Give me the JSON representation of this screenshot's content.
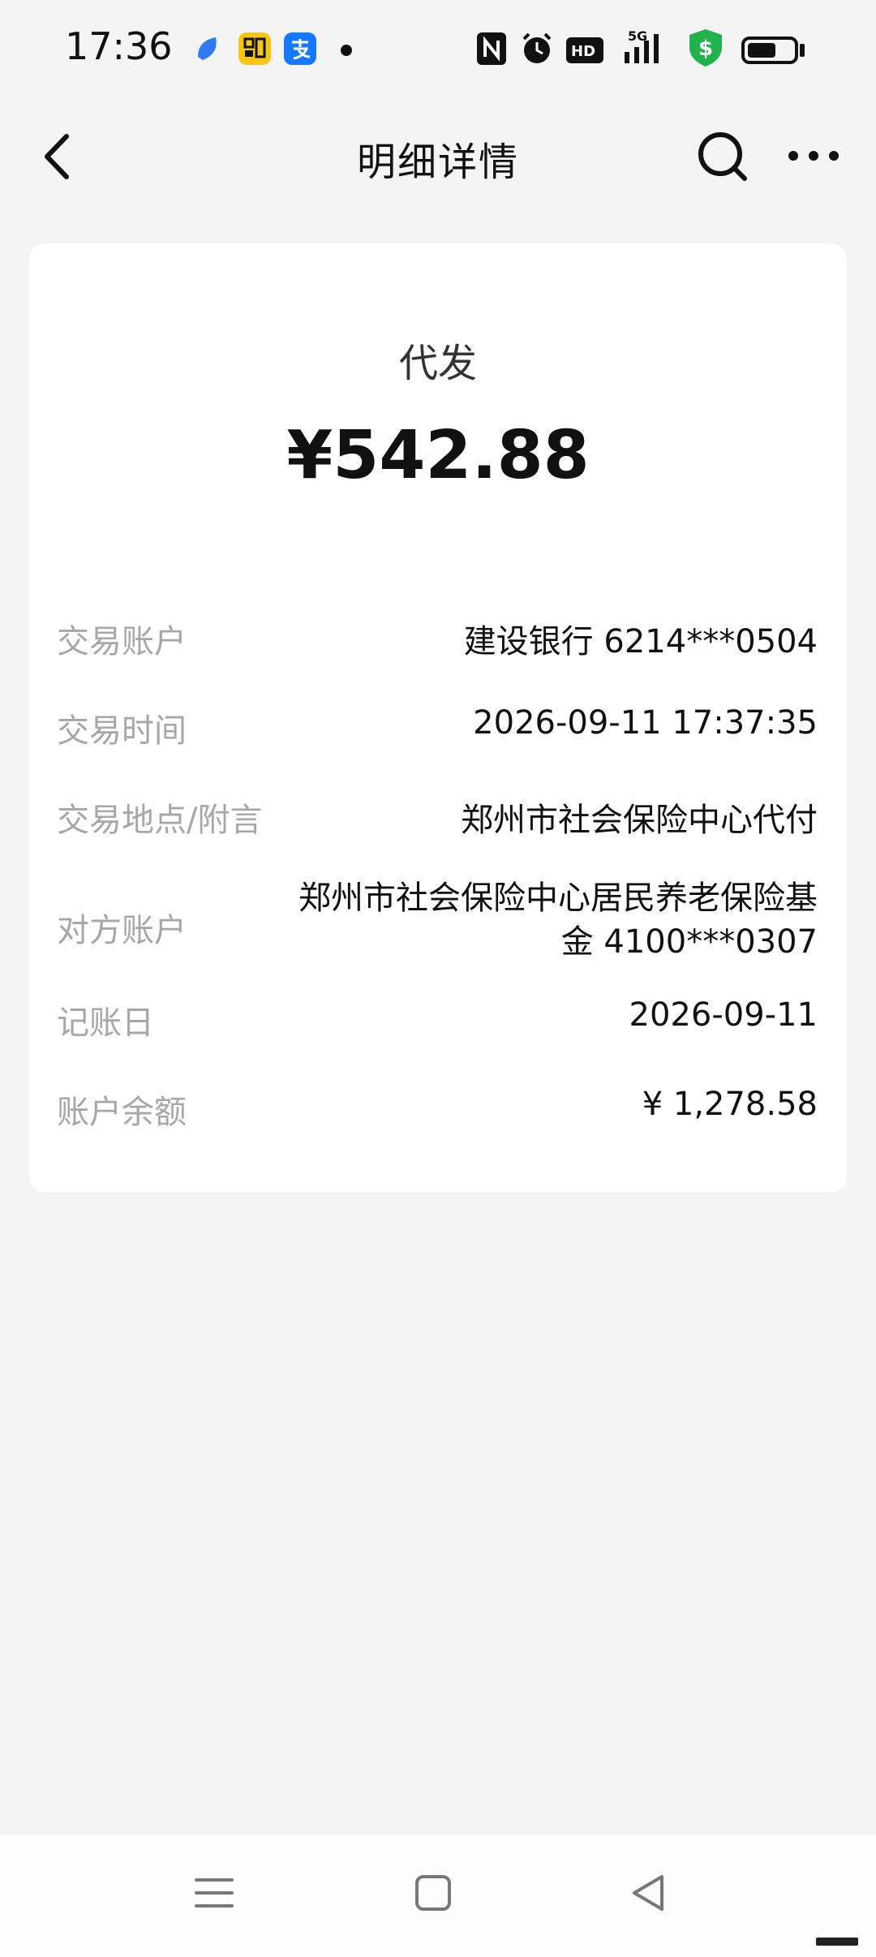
{
  "status_bar": {
    "time": "17:36",
    "notification_icons": [
      "app-blue-icon",
      "toutiao-icon",
      "alipay-icon"
    ],
    "system_icons": [
      "nfc-icon",
      "alarm-icon",
      "hd-icon",
      "signal-5g-icon",
      "shield-dollar-icon",
      "battery-icon"
    ],
    "colors": {
      "alipay": "#1677ff",
      "toutiao": "#f5c518",
      "shield": "#22b14c"
    }
  },
  "nav": {
    "title": "明细详情",
    "back_icon": "chevron-left-icon",
    "search_icon": "search-icon",
    "more_icon": "more-dots-icon"
  },
  "transaction": {
    "type": "代发",
    "amount": "¥542.88",
    "rows": [
      {
        "label": "交易账户",
        "value": "建设银行 6214***0504"
      },
      {
        "label": "交易时间",
        "value": "2026-09-11 17:37:35"
      },
      {
        "label": "交易地点/附言",
        "value": "郑州市社会保险中心代付"
      },
      {
        "label": "对方账户",
        "value_line1": "郑州市社会保险中心居民养老保险基",
        "value_line2": "金 4100***0307"
      },
      {
        "label": "记账日",
        "value": "2026-09-11"
      },
      {
        "label": "账户余额",
        "value": "¥ 1,278.58"
      }
    ]
  },
  "bottom_nav": {
    "icons": [
      "menu-icon",
      "home-square-icon",
      "back-triangle-icon"
    ]
  }
}
